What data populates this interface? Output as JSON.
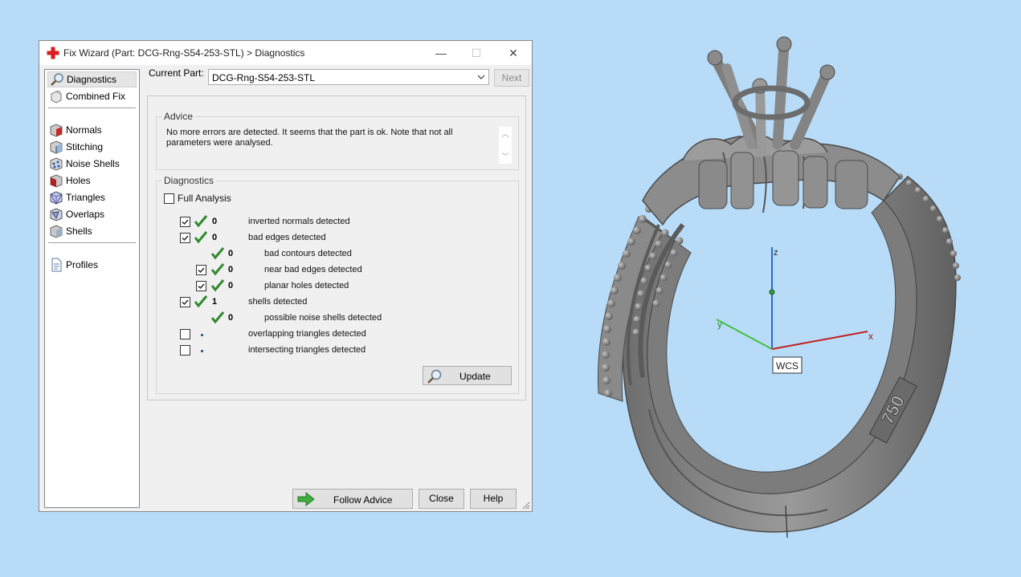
{
  "window": {
    "title": "Fix Wizard (Part: DCG-Rng-S54-253-STL) > Diagnostics",
    "min_glyph": "—",
    "max_glyph": "☐",
    "close_glyph": "✕"
  },
  "sidebar": {
    "items": [
      {
        "label": "Diagnostics",
        "icon": "magnifier-icon"
      },
      {
        "label": "Combined Fix",
        "icon": "combined-fix-icon"
      },
      {
        "label": "Normals",
        "icon": "normals-cube-icon"
      },
      {
        "label": "Stitching",
        "icon": "stitching-cube-icon"
      },
      {
        "label": "Noise Shells",
        "icon": "noise-shells-icon"
      },
      {
        "label": "Holes",
        "icon": "holes-cube-icon"
      },
      {
        "label": "Triangles",
        "icon": "triangles-cube-icon"
      },
      {
        "label": "Overlaps",
        "icon": "overlaps-cube-icon"
      },
      {
        "label": "Shells",
        "icon": "shells-cube-icon"
      },
      {
        "label": "Profiles",
        "icon": "profiles-document-icon"
      }
    ]
  },
  "current_part": {
    "label": "Current Part:",
    "value": "DCG-Rng-S54-253-STL",
    "next_label": "Next"
  },
  "advice": {
    "title": "Advice",
    "text": "No more errors are detected. It seems that the part is ok. Note that not all parameters were analysed."
  },
  "diagnostics": {
    "title": "Diagnostics",
    "full_analysis": "Full Analysis",
    "rows": [
      {
        "count": "0",
        "label": "inverted normals detected",
        "checked": true,
        "status": "ok"
      },
      {
        "count": "0",
        "label": "bad edges detected",
        "checked": true,
        "status": "ok"
      },
      {
        "count": "0",
        "label": "bad contours detected",
        "checked": null,
        "status": "ok"
      },
      {
        "count": "0",
        "label": "near bad edges detected",
        "checked": true,
        "status": "ok"
      },
      {
        "count": "0",
        "label": "planar holes detected",
        "checked": true,
        "status": "ok"
      },
      {
        "count": "1",
        "label": "shells detected",
        "checked": true,
        "status": "ok"
      },
      {
        "count": "0",
        "label": "possible noise shells detected",
        "checked": null,
        "status": "ok"
      },
      {
        "count": "",
        "label": "overlapping triangles detected",
        "checked": false,
        "status": "pending"
      },
      {
        "count": "",
        "label": "intersecting triangles detected",
        "checked": false,
        "status": "pending"
      }
    ],
    "update_label": "Update"
  },
  "footer": {
    "follow_advice": "Follow Advice",
    "close": "Close",
    "help": "Help"
  },
  "viewport": {
    "axis_z": "z",
    "axis_x": "x",
    "axis_y": "y",
    "wcs_label": "WCS",
    "hallmark": "750"
  },
  "colors": {
    "desktop": "#b8dcf8",
    "ok_tick": "#2e8b2e",
    "follow_arrow": "#3fae3f",
    "axis_x": "#c02020",
    "axis_y": "#40c040",
    "axis_z": "#2a6acd"
  }
}
